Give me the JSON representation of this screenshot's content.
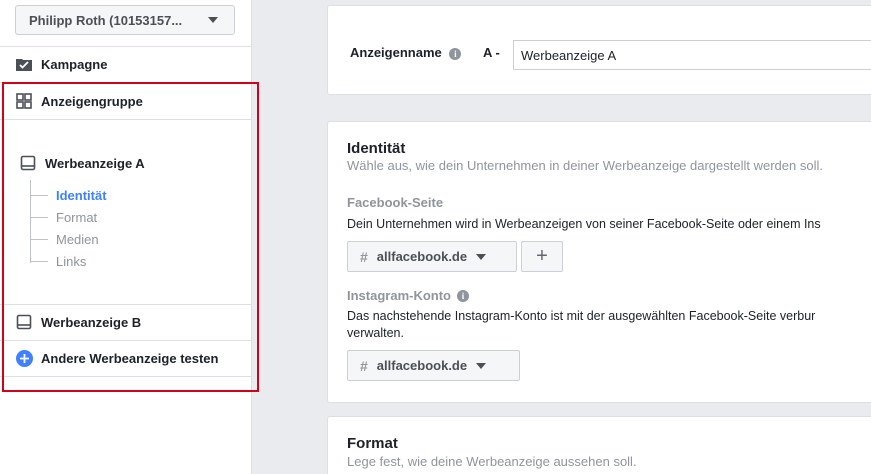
{
  "sidebar": {
    "account": "Philipp Roth (10153157...",
    "campaign": "Kampagne",
    "adset": "Anzeigengruppe",
    "ad_a": "Werbeanzeige A",
    "tree": [
      "Identität",
      "Format",
      "Medien",
      "Links"
    ],
    "ad_b": "Werbeanzeige B",
    "add_ad": "Andere Werbeanzeige testen"
  },
  "ad_name": {
    "label": "Anzeigenname",
    "prefix": "A -",
    "value": "Werbeanzeige A"
  },
  "identity": {
    "title": "Identität",
    "subtitle": "Wähle aus, wie dein Unternehmen in deiner Werbeanzeige dargestellt werden soll.",
    "fb_label": "Facebook-Seite",
    "fb_desc": "Dein Unternehmen wird in Werbeanzeigen von seiner Facebook-Seite oder einem Ins",
    "fb_page": "allfacebook.de",
    "add_symbol": "+",
    "ig_label": "Instagram-Konto",
    "ig_desc_1": "Das nachstehende Instagram-Konto ist mit der ausgewählten Facebook-Seite verbur",
    "ig_desc_2": "verwalten.",
    "ig_page": "allfacebook.de"
  },
  "format": {
    "title": "Format",
    "subtitle": "Lege fest, wie deine Werbeanzeige aussehen soll."
  },
  "colors": {
    "accent": "#4080ff",
    "highlight": "#d0021b"
  }
}
